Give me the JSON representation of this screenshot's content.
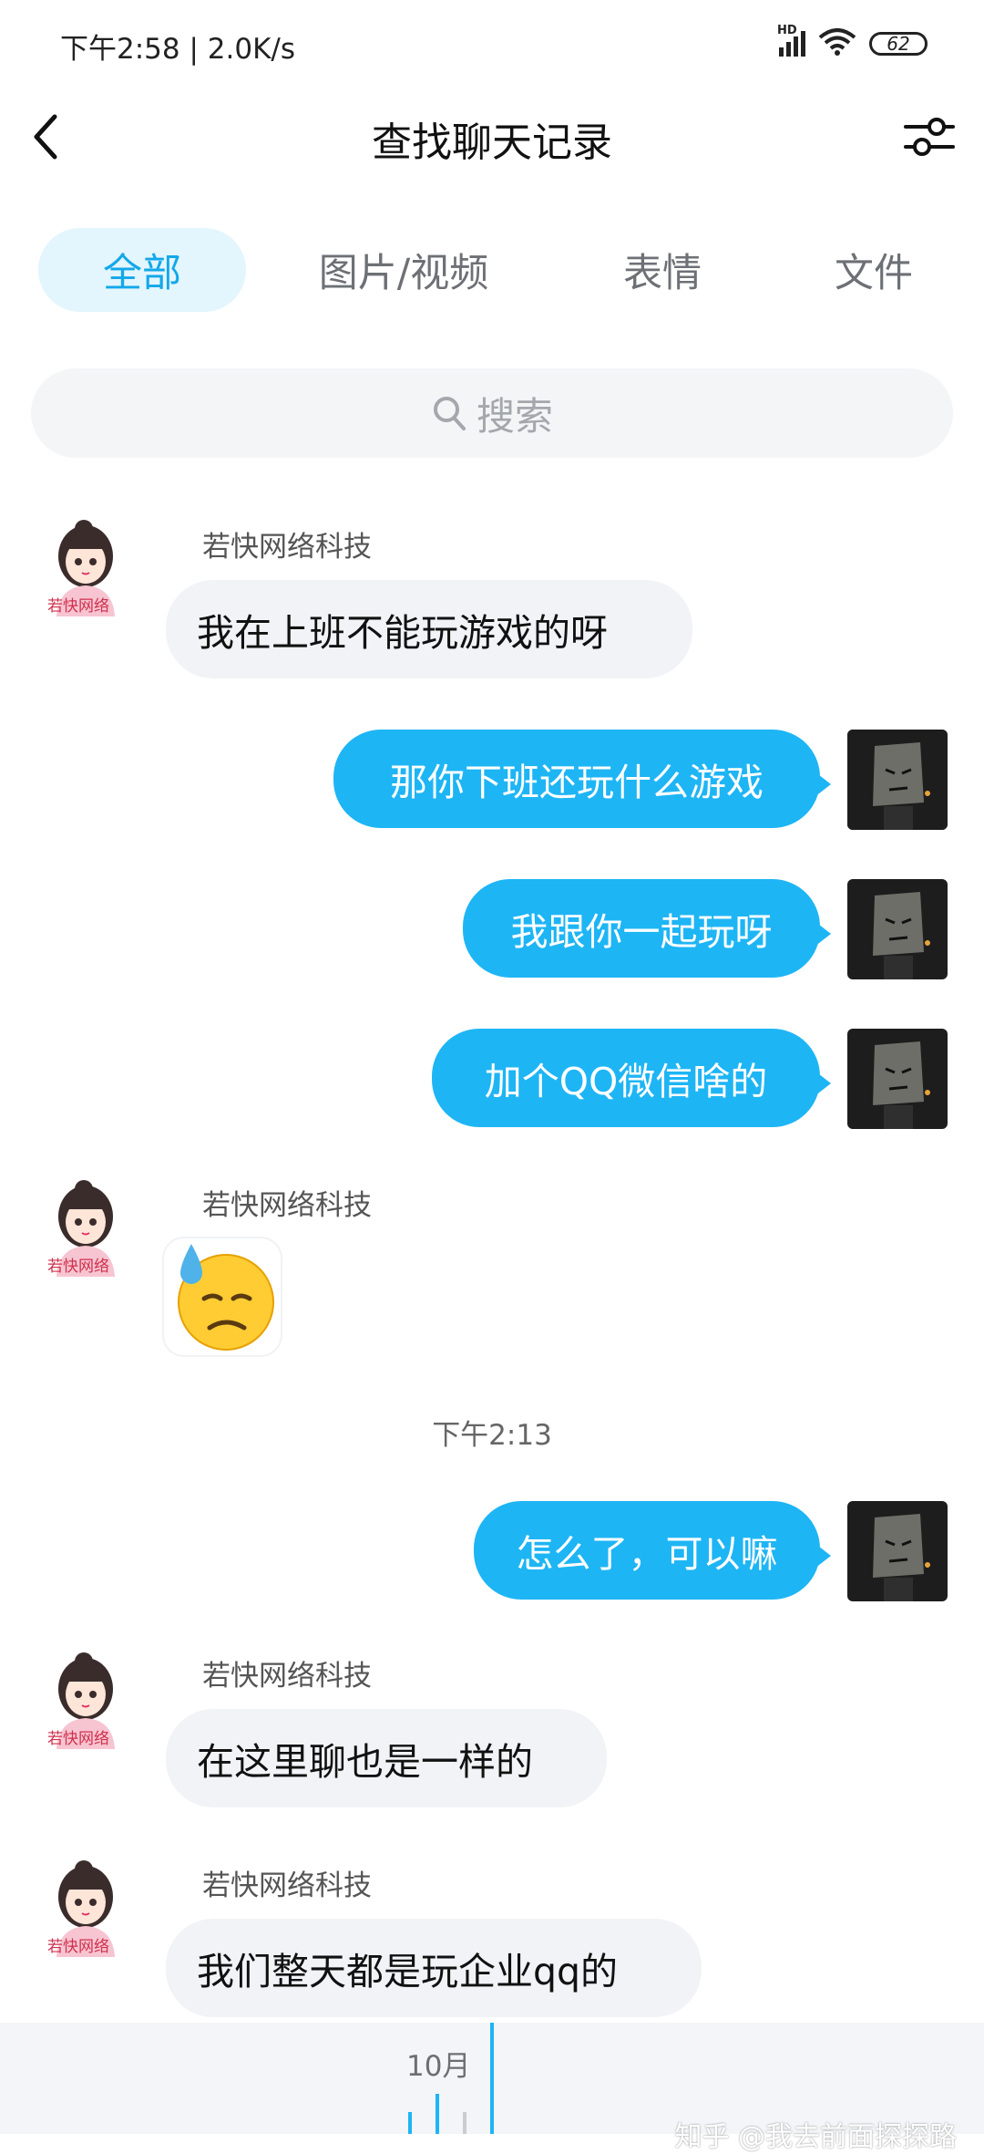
{
  "status_bar": {
    "time": "下午2:58 | 2.0K/s",
    "signal_label": "HD",
    "battery": "62"
  },
  "header": {
    "title": "查找聊天记录"
  },
  "tabs": [
    {
      "label": "全部",
      "active": true
    },
    {
      "label": "图片/视频",
      "active": false
    },
    {
      "label": "表情",
      "active": false
    },
    {
      "label": "文件",
      "active": false
    }
  ],
  "search": {
    "placeholder": "搜索"
  },
  "messages": [
    {
      "side": "left",
      "sender": "若快网络科技",
      "avatar_label": "若快网络",
      "text": "我在上班不能玩游戏的呀"
    },
    {
      "side": "right",
      "text": "那你下班还玩什么游戏"
    },
    {
      "side": "right",
      "text": "我跟你一起玩呀"
    },
    {
      "side": "right",
      "text": "加个QQ微信啥的"
    },
    {
      "side": "left",
      "sender": "若快网络科技",
      "avatar_label": "若快网络",
      "emoji": "😓"
    },
    {
      "side": "right",
      "text": "怎么了，可以嘛"
    },
    {
      "side": "left",
      "sender": "若快网络科技",
      "avatar_label": "若快网络",
      "text": "在这里聊也是一样的"
    },
    {
      "side": "left",
      "sender": "若快网络科技",
      "avatar_label": "若快网络",
      "text": "我们整天都是玩企业qq的"
    }
  ],
  "timestamp": "下午2:13",
  "timeline": {
    "month": "10月"
  },
  "watermark": "知乎 @我去前面探探路",
  "colors": {
    "accent": "#1eb5f5",
    "tab_active_bg": "#e3f5fd",
    "bubble_in": "#f1f3f6"
  }
}
